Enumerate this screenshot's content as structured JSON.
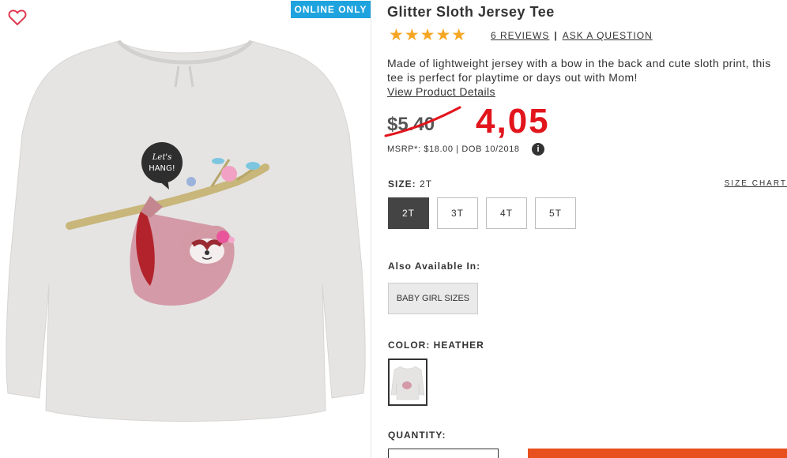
{
  "product": {
    "online_badge": "ONLINE ONLY",
    "title": "Glitter Sloth Jersey Tee",
    "rating_stars": "★★★★★",
    "reviews_link": "6 REVIEWS",
    "ask_link": "ASK A QUESTION",
    "description": "Made of lightweight jersey with a bow in the back and cute sloth print, this tee is perfect for playtime or days out with Mom!",
    "details_link": "View Product Details",
    "speech_bubble_text": "Let's HANG!"
  },
  "pricing": {
    "old_price": "$5.40",
    "handwritten_price": "4,05",
    "msrp": "MSRP*: $18.00 | DOB 10/2018",
    "info_icon": "i"
  },
  "size": {
    "label": "SIZE:",
    "selected": "2T",
    "chart_link": "SIZE CHART",
    "options": [
      "2T",
      "3T",
      "4T",
      "5T"
    ]
  },
  "also_available": {
    "label": "Also Available In:",
    "option": "BABY GIRL SIZES"
  },
  "color": {
    "label": "COLOR:",
    "value": "HEATHER"
  },
  "quantity": {
    "label": "QUANTITY:"
  },
  "colors": {
    "badge": "#1ea3de",
    "stars": "#f6a623",
    "handwritten": "#e2141c",
    "selected_size": "#444444",
    "add_to_bag": "#e8501e"
  },
  "icons": {
    "wishlist": "heart-outline-icon",
    "info": "info-circle-icon"
  }
}
